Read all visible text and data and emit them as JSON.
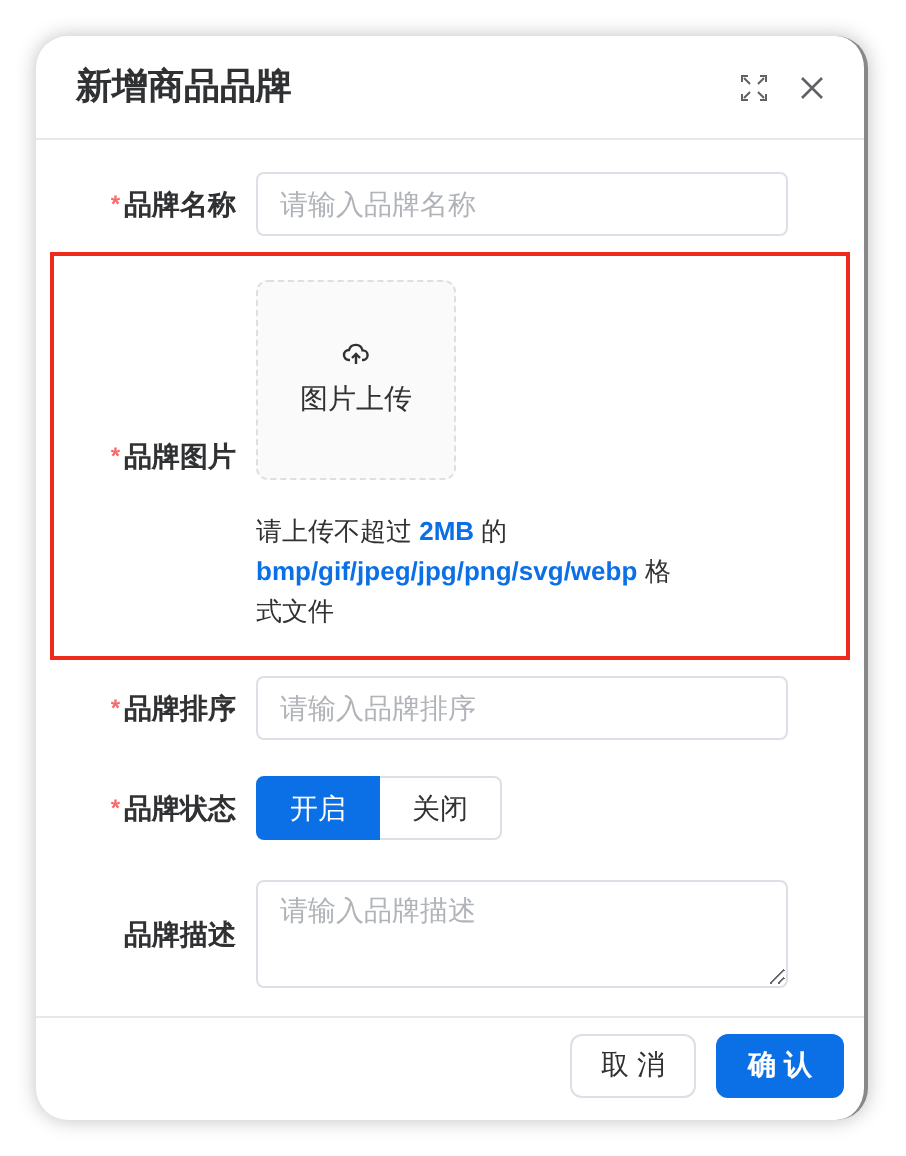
{
  "dialog": {
    "title": "新增商品品牌"
  },
  "fields": [
    {
      "kind": "input",
      "label": "品牌名称",
      "required_mark": "*",
      "placeholder": "请输入品牌名称"
    },
    {
      "kind": "upload",
      "label": "品牌图片",
      "required_mark": "*",
      "highlighted": true,
      "upload_text": "图片上传",
      "hint": [
        {
          "text": "请上传不超过 ",
          "emphasis": false
        },
        {
          "text": "2MB",
          "emphasis": true
        },
        {
          "text": " 的 ",
          "emphasis": false
        },
        {
          "text": "bmp/gif/jpeg/jpg/png/svg/webp",
          "emphasis": true
        },
        {
          "text": " 格式文件",
          "emphasis": false
        }
      ]
    },
    {
      "kind": "input",
      "label": "品牌排序",
      "required_mark": "*",
      "placeholder": "请输入品牌排序"
    },
    {
      "kind": "toggle",
      "label": "品牌状态",
      "required_mark": "*",
      "options": [
        {
          "label": "开启",
          "selected": true
        },
        {
          "label": "关闭",
          "selected": false
        }
      ]
    },
    {
      "kind": "textarea",
      "label": "品牌描述",
      "placeholder": "请输入品牌描述"
    }
  ],
  "buttons": [
    {
      "label": "取 消",
      "kind": "secondary"
    },
    {
      "label": "确 认",
      "kind": "primary"
    }
  ]
}
